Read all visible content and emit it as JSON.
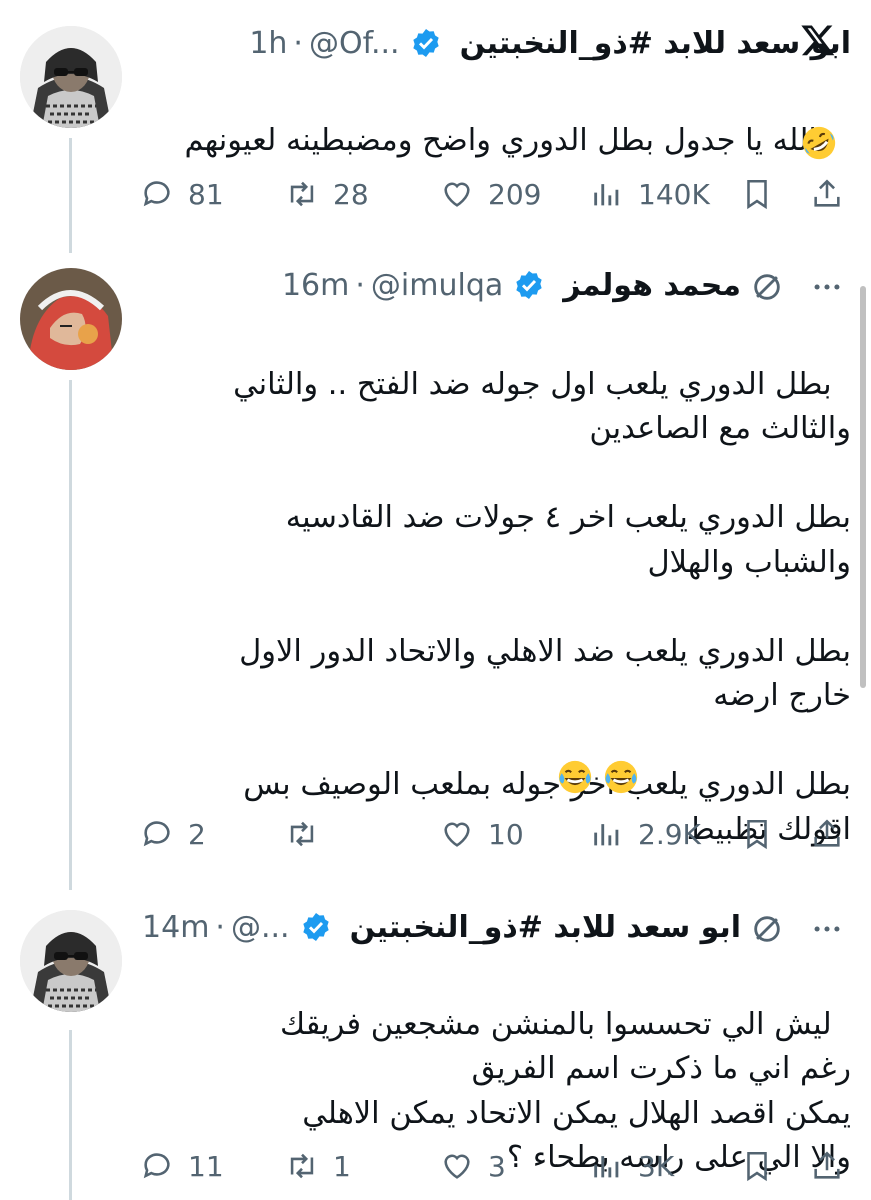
{
  "tweets": [
    {
      "display_name": "ابو سعد للابد #ذو_النخبتين",
      "handle": "@Of...",
      "time": "1h",
      "text": "والله يا جدول بطل الدوري واضح ومضبطينه لعيونهم",
      "emoji": "rolling-on-floor-laughing",
      "replies": "81",
      "reposts": "28",
      "likes": "209",
      "views": "140K"
    },
    {
      "display_name": "محمد هولمز",
      "handle": "@imulqa",
      "time": "16m",
      "text": "بطل الدوري يلعب اول جوله ضد الفتح .. والثاني\nوالثالث مع الصاعدين\n\nبطل الدوري يلعب اخر ٤ جولات ضد القادسيه\nوالشباب والهلال\n\nبطل الدوري يلعب ضد الاهلي والاتحاد الدور الاول\nخارج ارضه\n\nبطل الدوري يلعب اخر جوله بملعب الوصيف بس\nاقولك تظبيط",
      "emoji": "face-with-tears-of-joy",
      "replies": "2",
      "reposts": "",
      "likes": "10",
      "views": "2.9K"
    },
    {
      "display_name": "ابو سعد للابد #ذو_النخبتين",
      "handle": "@...",
      "time": "14m",
      "text": "ليش الي تحسسوا بالمنشن مشجعين فريقك\nرغم اني ما ذكرت اسم الفريق\nيمكن اقصد الهلال يمكن الاتحاد يمكن الاهلي\nوالا الي على راسه بطحاء ؟",
      "replies": "11",
      "reposts": "1",
      "likes": "3",
      "views": "3K"
    }
  ],
  "colors": {
    "text": "#0f1419",
    "secondary": "#536471",
    "verified": "#1d9bf0",
    "thread_line": "#cfd9de"
  },
  "icons": [
    "x-logo-icon",
    "verified-badge-icon",
    "reply-icon",
    "repost-icon",
    "like-icon",
    "views-icon",
    "bookmark-icon",
    "share-icon",
    "grok-icon",
    "more-icon"
  ]
}
